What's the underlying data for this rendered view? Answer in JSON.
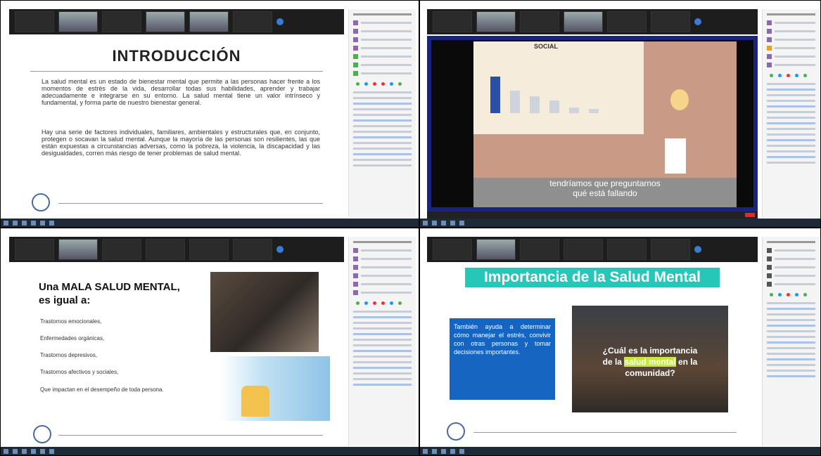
{
  "panel1": {
    "title": "INTRODUCCIÓN",
    "para1": "La salud mental es un estado de bienestar mental que permite a las personas hacer frente a los momentos de estrés de la vida, desarrollar todas sus habilidades, aprender y trabajar adecuadamente e integrarse en su entorno. La salud mental tiene un valor intrínseco y fundamental, y forma parte de nuestro bienestar general.",
    "para2": "Hay una serie de factores individuales, familiares, ambientales y estructurales que, en conjunto, protegen o socavan la salud mental. Aunque la mayoría de las personas son resilientes, las que están expuestas a circunstancias adversas, como la pobreza, la violencia, la discapacidad y las desigualdades, corren más riesgo de tener problemas de salud mental."
  },
  "panel2": {
    "heading": "SOCIAL",
    "subtitle_line1": "tendríamos que preguntarnos",
    "subtitle_line2": "qué está fallando"
  },
  "panel3": {
    "heading_line1": "Una MALA SALUD MENTAL,",
    "heading_line2": "es igual a:",
    "items": [
      "Trastornos emocionales,",
      "Enfermedades orgánicas,",
      "Trastornos depresivos,",
      "Trastornos afectivos y sociales,"
    ],
    "footer": "Que impactan en el desempeño de toda persona."
  },
  "panel4": {
    "title": "Importancia de la Salud Mental",
    "text": "También ayuda a determinar cómo manejar el estrés, convivir con otras personas y tomar decisiones importantes.",
    "question_a": "¿Cuál es la importancia",
    "question_b": "de la ",
    "question_hl": "salud mental",
    "question_c": " en la",
    "question_d": "comunidad?"
  },
  "colors": {
    "zoom_bar": "#1d1d1d",
    "teal": "#26c6b8",
    "blue": "#1565c0",
    "highlight": "#c6e83a",
    "bar_highlight": "#2b4fa8"
  },
  "icons": [
    "logo-icon",
    "reaction-dot-icon",
    "taskbar-app-icon"
  ]
}
